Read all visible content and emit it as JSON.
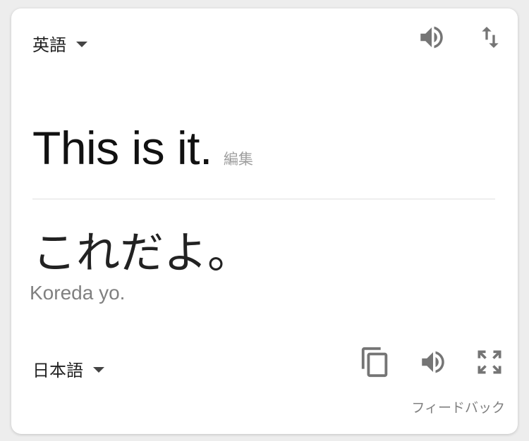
{
  "source": {
    "language": "英語",
    "text": "This is it.",
    "edit_label": "編集"
  },
  "target": {
    "language": "日本語",
    "text": "これだよ。",
    "romanization": "Koreda yo."
  },
  "feedback_label": "フィードバック",
  "icons": {
    "speaker": "speaker-icon",
    "swap": "swap-icon",
    "copy": "copy-icon",
    "expand": "fullscreen-icon"
  },
  "colors": {
    "icon": "#757575",
    "muted_text": "#808080"
  }
}
